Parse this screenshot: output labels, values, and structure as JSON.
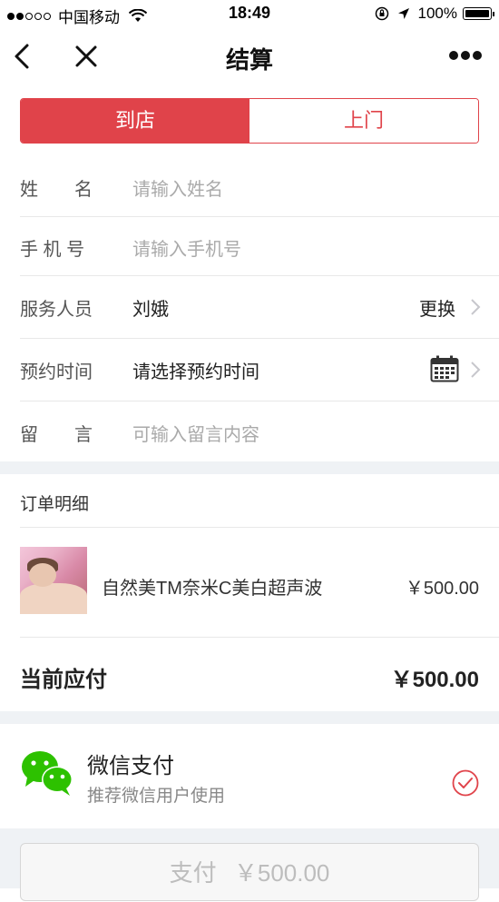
{
  "status_bar": {
    "carrier": "中国移动",
    "time": "18:49",
    "battery": "100%"
  },
  "nav": {
    "title": "结算"
  },
  "tabs": [
    {
      "label": "到店",
      "active": true
    },
    {
      "label": "上门",
      "active": false
    }
  ],
  "form": {
    "name": {
      "label": "姓　　名",
      "placeholder": "请输入姓名"
    },
    "phone": {
      "label": "手 机 号",
      "placeholder": "请输入手机号"
    },
    "staff": {
      "label": "服务人员",
      "value": "刘娥",
      "action": "更换"
    },
    "time": {
      "label": "预约时间",
      "value": "请选择预约时间"
    },
    "message": {
      "label": "留　　言",
      "placeholder": "可输入留言内容"
    }
  },
  "order": {
    "title": "订单明细",
    "item": {
      "name": "自然美TM奈米C美白超声波",
      "price": "￥500.00"
    },
    "total_label": "当前应付",
    "total_value": "￥500.00"
  },
  "payment": {
    "name": "微信支付",
    "desc": "推荐微信用户使用",
    "selected": true
  },
  "pay_button": {
    "label": "支付",
    "amount": "￥500.00"
  },
  "colors": {
    "accent": "#e0434a",
    "wechat_green": "#2dc100",
    "section_bg": "#eff2f5"
  }
}
